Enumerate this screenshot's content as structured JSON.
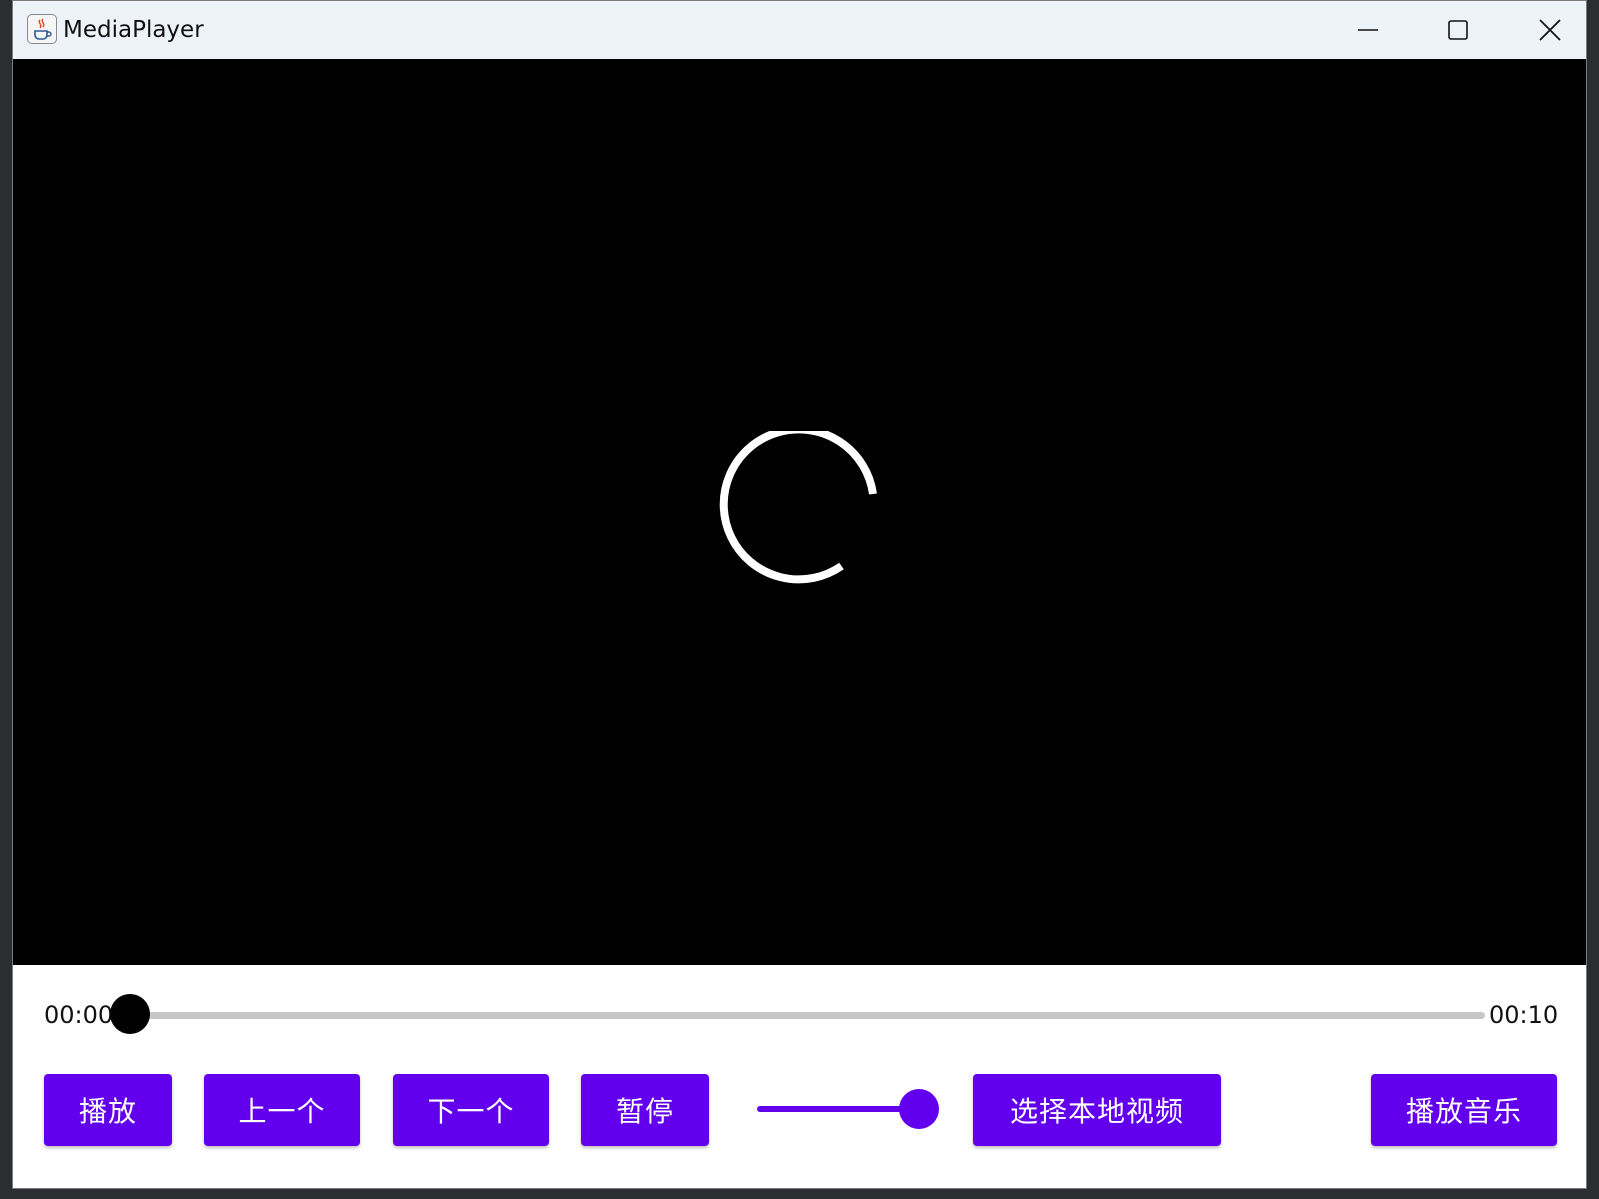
{
  "window": {
    "title": "MediaPlayer"
  },
  "player": {
    "state": "loading",
    "current_time": "00:00",
    "total_time": "00:10",
    "progress": 0.0,
    "volume": 1.0
  },
  "buttons": {
    "play": "播放",
    "previous": "上一个",
    "next": "下一个",
    "pause": "暂停",
    "select_local_video": "选择本地视频",
    "play_music": "播放音乐"
  },
  "colors": {
    "accent": "#6200ee",
    "video_background": "#000000",
    "titlebar": "#eef3fa"
  },
  "icons": {
    "app": "java-cup-icon",
    "minimize": "minimize-icon",
    "maximize": "maximize-icon",
    "close": "close-icon",
    "loading": "loading-spinner-icon"
  }
}
